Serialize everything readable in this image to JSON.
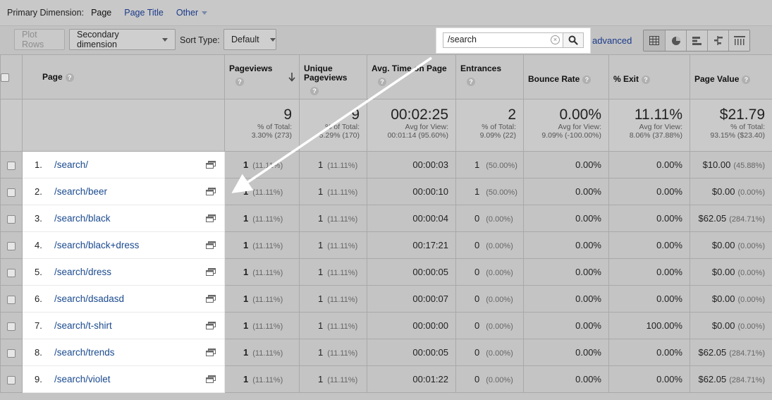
{
  "dimension_bar": {
    "label": "Primary Dimension:",
    "current": "Page",
    "links": [
      "Page Title",
      "Other"
    ]
  },
  "toolbar": {
    "plot_rows": "Plot Rows",
    "secondary_dimension": "Secondary dimension",
    "sort_type_label": "Sort Type:",
    "sort_type_value": "Default",
    "search_value": "/search",
    "advanced": "advanced",
    "view_icons": [
      "table-view-icon",
      "pie-view-icon",
      "performance-view-icon",
      "comparison-view-icon",
      "pivot-view-icon"
    ]
  },
  "table": {
    "headers": {
      "page": "Page",
      "pageviews": "Pageviews",
      "unique_pageviews": "Unique Pageviews",
      "avg_time": "Avg. Time on Page",
      "entrances": "Entrances",
      "bounce_rate": "Bounce Rate",
      "exit": "% Exit",
      "page_value": "Page Value"
    },
    "totals": {
      "pageviews": {
        "value": "9",
        "line1": "% of Total:",
        "line2": "3.30% (273)"
      },
      "unique_pageviews": {
        "value": "9",
        "line1": "% of Total:",
        "line2": "5.29% (170)"
      },
      "avg_time": {
        "value": "00:02:25",
        "line1": "Avg for View:",
        "line2": "00:01:14 (95.60%)"
      },
      "entrances": {
        "value": "2",
        "line1": "% of Total:",
        "line2": "9.09% (22)"
      },
      "bounce_rate": {
        "value": "0.00%",
        "line1": "Avg for View:",
        "line2": "9.09% (-100.00%)"
      },
      "exit": {
        "value": "11.11%",
        "line1": "Avg for View:",
        "line2": "8.06% (37.88%)"
      },
      "page_value": {
        "value": "$21.79",
        "line1": "% of Total:",
        "line2": "93.15% ($23.40)"
      }
    },
    "rows": [
      {
        "rank": "1.",
        "page": "/search/",
        "pv": "1",
        "pv_pct": "(11.11%)",
        "upv": "1",
        "upv_pct": "(11.11%)",
        "time": "00:00:03",
        "ent": "1",
        "ent_pct": "(50.00%)",
        "bounce": "0.00%",
        "exit": "0.00%",
        "value": "$10.00",
        "value_pct": "(45.88%)"
      },
      {
        "rank": "2.",
        "page": "/search/beer",
        "pv": "1",
        "pv_pct": "(11.11%)",
        "upv": "1",
        "upv_pct": "(11.11%)",
        "time": "00:00:10",
        "ent": "1",
        "ent_pct": "(50.00%)",
        "bounce": "0.00%",
        "exit": "0.00%",
        "value": "$0.00",
        "value_pct": "(0.00%)"
      },
      {
        "rank": "3.",
        "page": "/search/black",
        "pv": "1",
        "pv_pct": "(11.11%)",
        "upv": "1",
        "upv_pct": "(11.11%)",
        "time": "00:00:04",
        "ent": "0",
        "ent_pct": "(0.00%)",
        "bounce": "0.00%",
        "exit": "0.00%",
        "value": "$62.05",
        "value_pct": "(284.71%)"
      },
      {
        "rank": "4.",
        "page": "/search/black+dress",
        "pv": "1",
        "pv_pct": "(11.11%)",
        "upv": "1",
        "upv_pct": "(11.11%)",
        "time": "00:17:21",
        "ent": "0",
        "ent_pct": "(0.00%)",
        "bounce": "0.00%",
        "exit": "0.00%",
        "value": "$0.00",
        "value_pct": "(0.00%)"
      },
      {
        "rank": "5.",
        "page": "/search/dress",
        "pv": "1",
        "pv_pct": "(11.11%)",
        "upv": "1",
        "upv_pct": "(11.11%)",
        "time": "00:00:05",
        "ent": "0",
        "ent_pct": "(0.00%)",
        "bounce": "0.00%",
        "exit": "0.00%",
        "value": "$0.00",
        "value_pct": "(0.00%)"
      },
      {
        "rank": "6.",
        "page": "/search/dsadasd",
        "pv": "1",
        "pv_pct": "(11.11%)",
        "upv": "1",
        "upv_pct": "(11.11%)",
        "time": "00:00:07",
        "ent": "0",
        "ent_pct": "(0.00%)",
        "bounce": "0.00%",
        "exit": "0.00%",
        "value": "$0.00",
        "value_pct": "(0.00%)"
      },
      {
        "rank": "7.",
        "page": "/search/t-shirt",
        "pv": "1",
        "pv_pct": "(11.11%)",
        "upv": "1",
        "upv_pct": "(11.11%)",
        "time": "00:00:00",
        "ent": "0",
        "ent_pct": "(0.00%)",
        "bounce": "0.00%",
        "exit": "100.00%",
        "value": "$0.00",
        "value_pct": "(0.00%)"
      },
      {
        "rank": "8.",
        "page": "/search/trends",
        "pv": "1",
        "pv_pct": "(11.11%)",
        "upv": "1",
        "upv_pct": "(11.11%)",
        "time": "00:00:05",
        "ent": "0",
        "ent_pct": "(0.00%)",
        "bounce": "0.00%",
        "exit": "0.00%",
        "value": "$62.05",
        "value_pct": "(284.71%)"
      },
      {
        "rank": "9.",
        "page": "/search/violet",
        "pv": "1",
        "pv_pct": "(11.11%)",
        "upv": "1",
        "upv_pct": "(11.11%)",
        "time": "00:01:22",
        "ent": "0",
        "ent_pct": "(0.00%)",
        "bounce": "0.00%",
        "exit": "0.00%",
        "value": "$62.05",
        "value_pct": "(284.71%)"
      }
    ]
  },
  "colors": {
    "link": "#1a4a8e",
    "dim_overlay": "#c4c4c4",
    "highlight": "#ffffff"
  }
}
